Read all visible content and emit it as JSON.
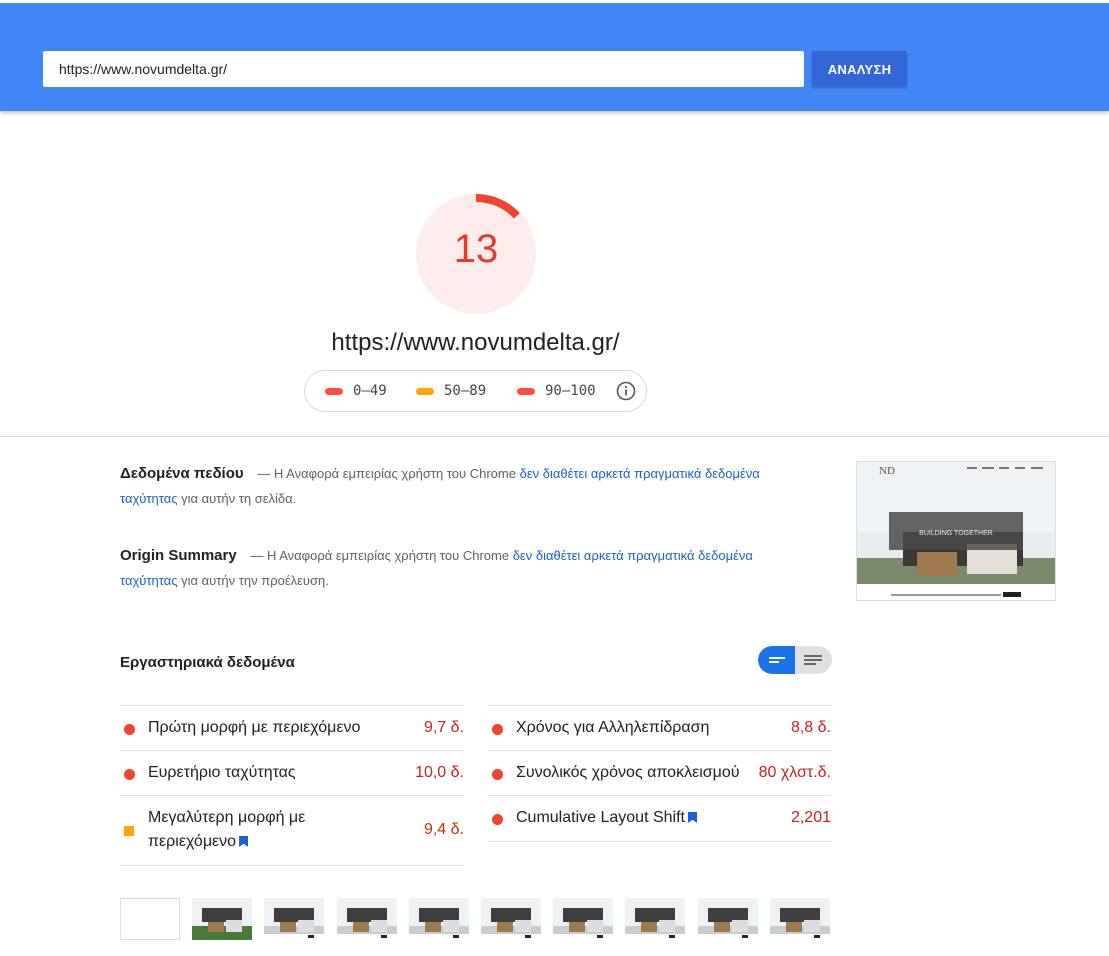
{
  "search": {
    "url_value": "https://www.novumdelta.gr/",
    "analyze_label": "ΑΝΑΛΥΣΗ"
  },
  "score": {
    "value": "13",
    "fraction": 0.13,
    "color": "#f0442f",
    "bg_color": "#fdeceb"
  },
  "audited_url": "https://www.novumdelta.gr/",
  "legend": {
    "items": [
      {
        "label": "0–49",
        "color": "#ff4e42"
      },
      {
        "label": "50–89",
        "color": "#ffa400"
      },
      {
        "label": "90–100",
        "color": "#ff4e42"
      }
    ],
    "info_icon": "info-icon"
  },
  "field_data": {
    "title": "Δεδομένα πεδίου",
    "intro": "— Η Αναφορά εμπειρίας χρήστη του Chrome",
    "link": "δεν διαθέτει αρκετά πραγματικά δεδομένα ταχύτητας",
    "suffix": "για αυτήν τη σελίδα."
  },
  "origin_summary": {
    "title": "Origin Summary",
    "intro": "— Η Αναφορά εμπειρίας χρήστη του Chrome",
    "link": "δεν διαθέτει αρκετά πραγματικά δεδομένα ταχύτητας",
    "suffix": "για αυτήν την προέλευση."
  },
  "screenshot": {
    "banner_text": "BUILDING TOGETHER",
    "logo_text": "ND"
  },
  "lab_data": {
    "title": "Εργαστηριακά δεδομένα",
    "metrics_left": [
      {
        "label": "Πρώτη μορφή με περιεχόμενο",
        "value": "9,7 δ.",
        "status": "fail"
      },
      {
        "label": "Ευρετήριο ταχύτητας",
        "value": "10,0 δ.",
        "status": "fail"
      },
      {
        "label_line1": "Μεγαλύτερη μορφή με",
        "label_line2": "περιεχόμενο",
        "value": "9,4 δ.",
        "status": "average"
      }
    ],
    "metrics_right": [
      {
        "label": "Χρόνος για Αλληλεπίδραση",
        "value": "8,8 δ.",
        "status": "fail"
      },
      {
        "label": "Συνολικός χρόνος αποκλεισμού",
        "value": "80 χλστ.δ.",
        "status": "fail"
      },
      {
        "label": "Cumulative Layout Shift",
        "value": "2,201",
        "status": "fail"
      }
    ]
  }
}
